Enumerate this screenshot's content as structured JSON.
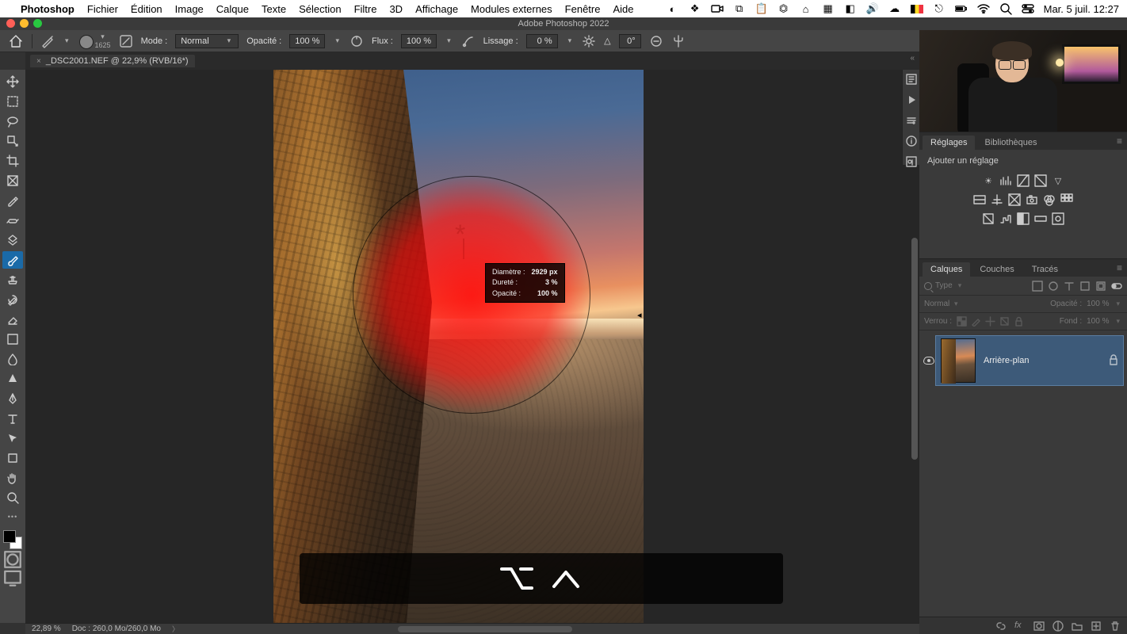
{
  "mac_menu": {
    "app": "Photoshop",
    "items": [
      "Fichier",
      "Édition",
      "Image",
      "Calque",
      "Texte",
      "Sélection",
      "Filtre",
      "3D",
      "Affichage",
      "Modules externes",
      "Fenêtre",
      "Aide"
    ],
    "clock": "Mar. 5 juil.  12:27"
  },
  "window": {
    "title": "Adobe Photoshop 2022"
  },
  "tab": {
    "label": "_DSC2001.NEF @ 22,9% (RVB/16*)"
  },
  "options": {
    "brush_size": "1625",
    "mode_label": "Mode :",
    "mode_value": "Normal",
    "opacity_label": "Opacité :",
    "opacity_value": "100 %",
    "flow_label": "Flux :",
    "flow_value": "100 %",
    "smooth_label": "Lissage :",
    "smooth_value": "0 %",
    "angle_label": "△",
    "angle_value": "0°"
  },
  "brush_hud": {
    "row1_label": "Diamètre :",
    "row1_value": "2929 px",
    "row2_label": "Dureté :",
    "row2_value": "3 %",
    "row3_label": "Opacité :",
    "row3_value": "100 %"
  },
  "status": {
    "zoom": "22,89 %",
    "doc": "Doc : 260,0 Mo/260,0 Mo"
  },
  "reglages": {
    "tabs": [
      "Réglages",
      "Bibliothèques"
    ],
    "hint": "Ajouter un réglage"
  },
  "layers": {
    "tabs": [
      "Calques",
      "Couches",
      "Tracés"
    ],
    "filter_placeholder": "Type",
    "blend_label": "Normal",
    "opacity_label": "Opacité :",
    "opacity_value": "100 %",
    "lock_label": "Verrou :",
    "fill_label": "Fond :",
    "fill_value": "100 %",
    "layer0": "Arrière-plan"
  }
}
